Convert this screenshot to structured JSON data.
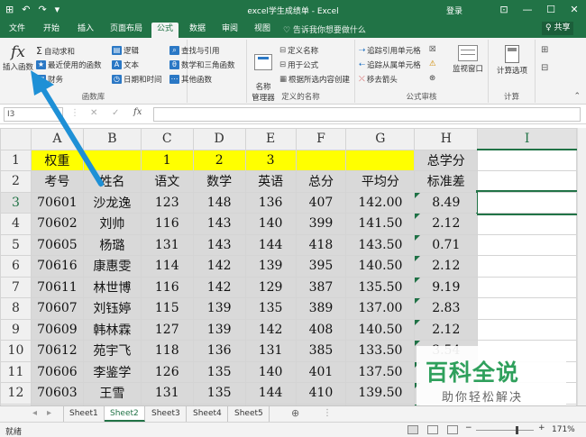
{
  "titlebar": {
    "title": "excel学生成绩单 - Excel",
    "login": "登录",
    "qat": [
      "⊞",
      "↶",
      "↷",
      "▾"
    ],
    "controls": [
      "⊡",
      "—",
      "☐",
      "✕"
    ]
  },
  "menubar": {
    "tabs": [
      "文件",
      "开始",
      "插入",
      "页面布局",
      "公式",
      "数据",
      "审阅",
      "视图"
    ],
    "active": "公式",
    "tellme": "♡ 告诉我你想要做什么",
    "share": "♀ 共享"
  },
  "ribbon": {
    "insert_fn": {
      "glyph": "fx",
      "label": "插入函数"
    },
    "lib_col1": [
      "自动求和",
      "最近使用的函数",
      "财务"
    ],
    "lib_col2": [
      "逻辑",
      "文本",
      "日期和时间"
    ],
    "lib_col3": [
      "查找与引用",
      "数学和三角函数",
      "其他函数"
    ],
    "lib_label": "函数库",
    "name_mgr": "名称\n管理器",
    "names_col": [
      "定义名称",
      "用于公式",
      "根据所选内容创建"
    ],
    "names_label": "定义的名称",
    "audit_col1": [
      "追踪引用单元格",
      "追踪从属单元格",
      "移去箭头"
    ],
    "audit_col2": [
      "☒",
      "⚠",
      "⊛"
    ],
    "watch": "监视窗口",
    "audit_label": "公式审核",
    "calc_opts": "计算选项",
    "calc_label": "计算"
  },
  "formula_bar": {
    "namebox": "I3",
    "fx": "fx",
    "icons": [
      "✕",
      "✓"
    ]
  },
  "sheet": {
    "col_headers": [
      "A",
      "B",
      "C",
      "D",
      "E",
      "F",
      "G",
      "H",
      "I"
    ],
    "row_headers": [
      "1",
      "2",
      "3",
      "4",
      "5",
      "6",
      "7",
      "8",
      "9",
      "10",
      "11",
      "12",
      "13"
    ],
    "row1": [
      "权重",
      "",
      "1",
      "2",
      "3",
      "",
      "",
      "总学分",
      ""
    ],
    "row2": [
      "考号",
      "姓名",
      "语文",
      "数学",
      "英语",
      "总分",
      "平均分",
      "标准差",
      ""
    ],
    "data": [
      [
        "70601",
        "沙龙逸",
        "123",
        "148",
        "136",
        "407",
        "142.00",
        "8.49"
      ],
      [
        "70602",
        "刘帅",
        "116",
        "143",
        "140",
        "399",
        "141.50",
        "2.12"
      ],
      [
        "70605",
        "杨璐",
        "131",
        "143",
        "144",
        "418",
        "143.50",
        "0.71"
      ],
      [
        "70616",
        "康惠雯",
        "114",
        "142",
        "139",
        "395",
        "140.50",
        "2.12"
      ],
      [
        "70611",
        "林世博",
        "116",
        "142",
        "129",
        "387",
        "135.50",
        "9.19"
      ],
      [
        "70607",
        "刘钰婷",
        "115",
        "139",
        "135",
        "389",
        "137.00",
        "2.83"
      ],
      [
        "70609",
        "韩林霖",
        "127",
        "139",
        "142",
        "408",
        "140.50",
        "2.12"
      ],
      [
        "70612",
        "苑宇飞",
        "118",
        "136",
        "131",
        "385",
        "133.50",
        "3.54"
      ],
      [
        "70606",
        "李鉴学",
        "126",
        "135",
        "140",
        "401",
        "137.50",
        ""
      ],
      [
        "70603",
        "王雪",
        "131",
        "135",
        "144",
        "410",
        "139.50",
        ""
      ],
      [
        "70604",
        "韩雨萌",
        "129",
        "133",
        "138",
        "400",
        "135.50",
        ""
      ]
    ]
  },
  "sheet_tabs": {
    "tabs": [
      "Sheet1",
      "Sheet2",
      "Sheet3",
      "Sheet4",
      "Sheet5"
    ],
    "active": "Sheet2",
    "nav": [
      "◂",
      "▸"
    ],
    "add": "⊕",
    "more": "⋮"
  },
  "statusbar": {
    "status": "就绪",
    "zoom": "171%",
    "minus": "−",
    "plus": "+"
  },
  "watermark": {
    "main": "百科全说",
    "sub": "助你轻松解决"
  },
  "colors": {
    "excel_green": "#217346",
    "yellow_fill": "#ffff00",
    "gray_fill": "#d9d9d9",
    "arrow": "#1e90d6",
    "watermark_green": "#2fa05c"
  }
}
